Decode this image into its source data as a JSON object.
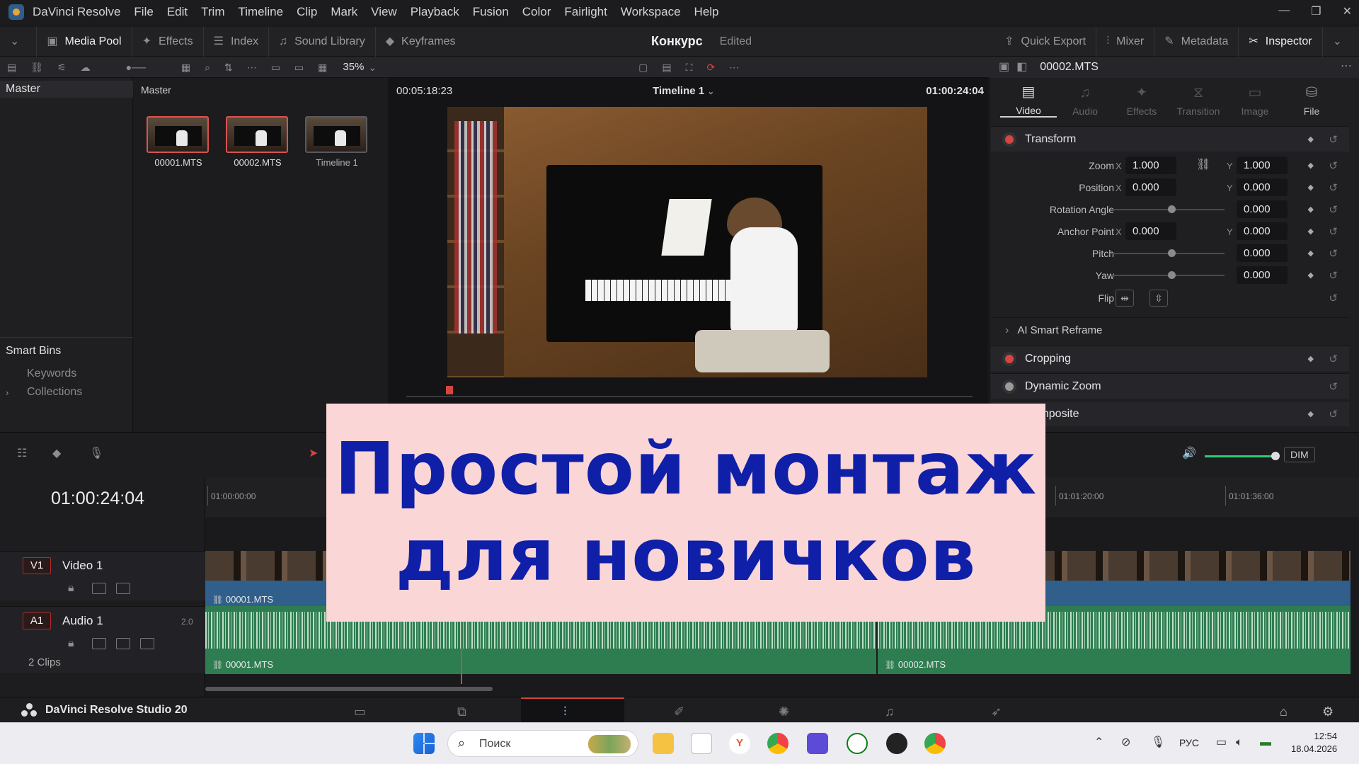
{
  "menu": {
    "app_name": "DaVinci Resolve",
    "items": [
      "File",
      "Edit",
      "Trim",
      "Timeline",
      "Clip",
      "Mark",
      "View",
      "Playback",
      "Fusion",
      "Color",
      "Fairlight",
      "Workspace",
      "Help"
    ],
    "window_controls": [
      "—",
      "❐",
      "✕"
    ]
  },
  "toolbar": {
    "media_pool": "Media Pool",
    "effects": "Effects",
    "index": "Index",
    "sound_library": "Sound Library",
    "keyframes": "Keyframes",
    "project_title": "Конкурс",
    "project_state": "Edited",
    "quick_export": "Quick Export",
    "mixer": "Mixer",
    "metadata": "Metadata",
    "inspector": "Inspector"
  },
  "subbar": {
    "zoom": "35%"
  },
  "left_panel": {
    "master": "Master",
    "smart_bins": "Smart Bins",
    "keywords": "Keywords",
    "collections": "Collections"
  },
  "media_pool": {
    "header": "Master",
    "clips": [
      {
        "name": "00001.MTS"
      },
      {
        "name": "00002.MTS"
      },
      {
        "name": "Timeline 1"
      }
    ]
  },
  "viewer": {
    "source_timecode": "00:05:18:23",
    "timeline_name": "Timeline 1",
    "record_timecode": "01:00:24:04"
  },
  "inspector": {
    "clip_name": "00002.MTS",
    "tabs": [
      "Video",
      "Audio",
      "Effects",
      "Transition",
      "Image",
      "File"
    ],
    "transform": "Transform",
    "props": {
      "zoom": {
        "label": "Zoom",
        "x": "1.000",
        "y": "1.000"
      },
      "position": {
        "label": "Position",
        "x": "0.000",
        "y": "0.000"
      },
      "rotation": {
        "label": "Rotation Angle",
        "value": "0.000"
      },
      "anchor": {
        "label": "Anchor Point",
        "x": "0.000",
        "y": "0.000"
      },
      "pitch": {
        "label": "Pitch",
        "value": "0.000"
      },
      "yaw": {
        "label": "Yaw",
        "value": "0.000"
      },
      "flip": {
        "label": "Flip"
      }
    },
    "axis_x": "X",
    "axis_y": "Y",
    "ai_smart_reframe": "AI Smart Reframe",
    "cropping": "Cropping",
    "dynamic_zoom": "Dynamic Zoom",
    "composite": "Composite"
  },
  "timeline": {
    "timecode": "01:00:24:04",
    "dim": "DIM",
    "ruler": [
      "01:00:00:00",
      "01:01:20:00",
      "01:01:36:00"
    ],
    "v1": {
      "badge": "V1",
      "name": "Video 1"
    },
    "a1": {
      "badge": "A1",
      "name": "Audio 1",
      "channels": "2.0",
      "clips": "2 Clips"
    },
    "video_clips": [
      "00001.MTS"
    ],
    "audio_clips": [
      "00001.MTS",
      "00002.MTS"
    ]
  },
  "pagebar": {
    "brand": "DaVinci Resolve Studio 20"
  },
  "overlay": {
    "line1": "Простой монтаж",
    "line2": "для новичков"
  },
  "taskbar": {
    "search_placeholder": "Поиск",
    "lang": "РУС",
    "time": "12:54",
    "date": "18.04.2026"
  }
}
